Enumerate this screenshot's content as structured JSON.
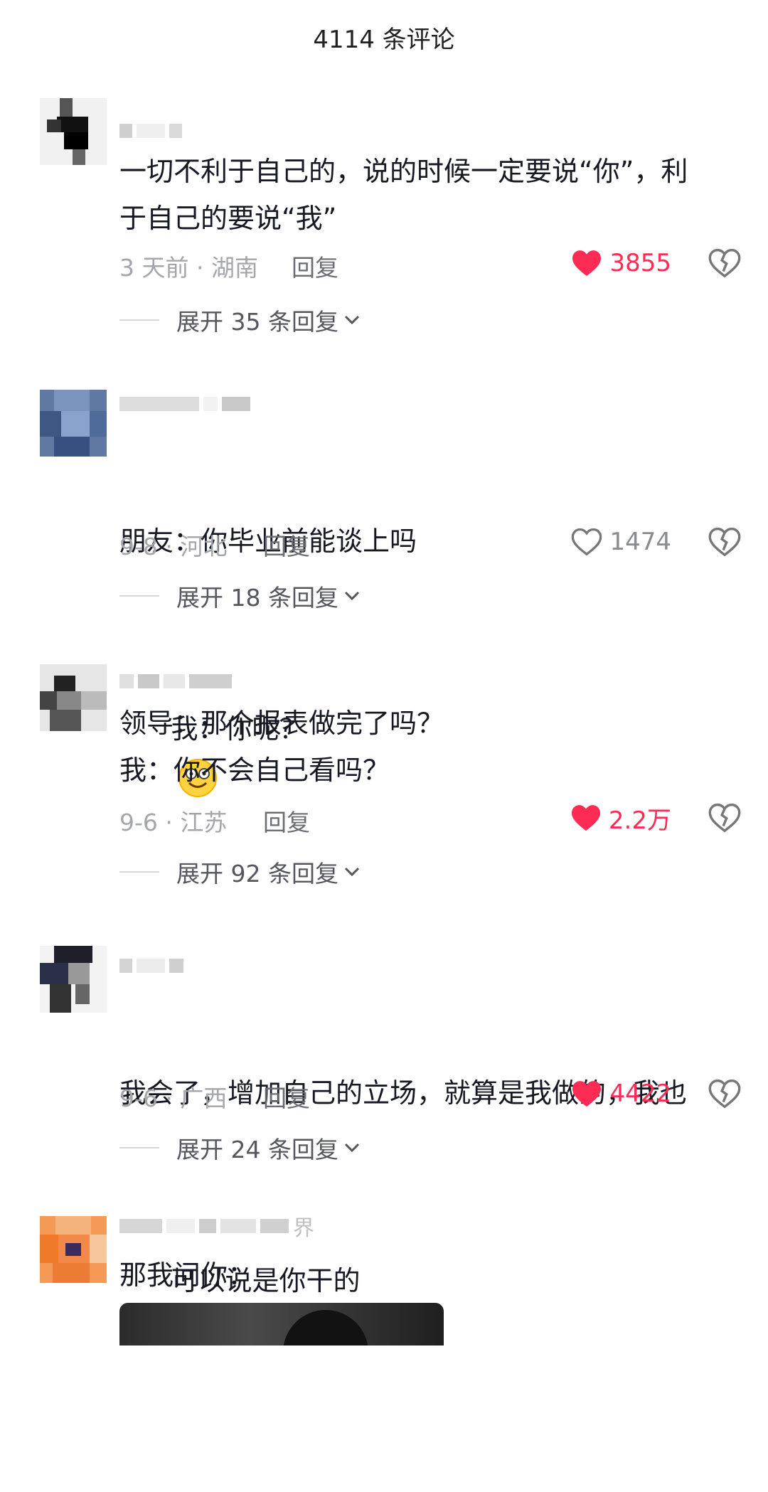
{
  "header": {
    "title": "4114 条评论"
  },
  "comments": [
    {
      "text": "一切不利于自己的，说的时候一定要说“你”，利\n于自己的要说“我”",
      "time": "3 天前 · 湖南",
      "reply": "回复",
      "likes": "3855",
      "liked": true,
      "expand": "展开 35 条回复"
    },
    {
      "text_line1": "朋友：你毕业前能谈上吗",
      "text_line2": "我：你呢？",
      "time": "9-8 · 河北",
      "reply": "回复",
      "likes": "1474",
      "liked": false,
      "expand": "展开 18 条回复"
    },
    {
      "text": "领导：那个报表做完了吗？\n我：你不会自己看吗？",
      "time": "9-6 · 江苏",
      "reply": "回复",
      "likes": "2.2万",
      "liked": true,
      "expand": "展开 92 条回复"
    },
    {
      "text_line1": "我会了，增加自己的立场，就算是我做的，我也",
      "text_line2": "可以说是你干的",
      "time": "9-6 · 广西",
      "reply": "回复",
      "likes": "4422",
      "liked": true,
      "expand": "展开 24 条回复"
    },
    {
      "name_partial": "界",
      "text": "那我问你："
    }
  ],
  "colors": {
    "like_active": "#fe2c55",
    "muted": "#a5a6ab"
  }
}
